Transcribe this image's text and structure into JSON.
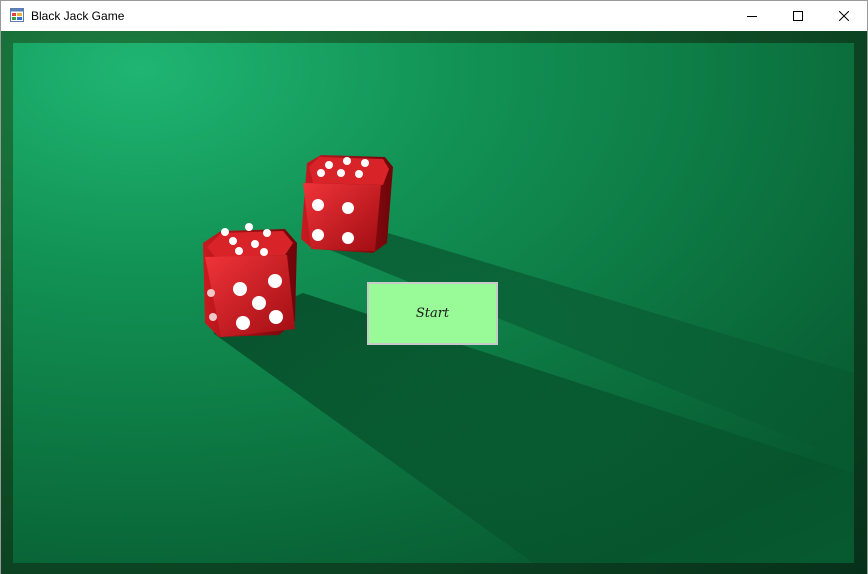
{
  "window": {
    "title": "Black Jack Game",
    "app_icon": "windows-form-icon",
    "controls": [
      "minimize-icon",
      "maximize-icon",
      "close-icon"
    ]
  },
  "background": {
    "description_icon": "green-felt-with-red-dice",
    "felt_color": "#12804a",
    "dice_color": "#d0161c"
  },
  "start_button": {
    "label": "Start",
    "color": "#98fb98"
  }
}
